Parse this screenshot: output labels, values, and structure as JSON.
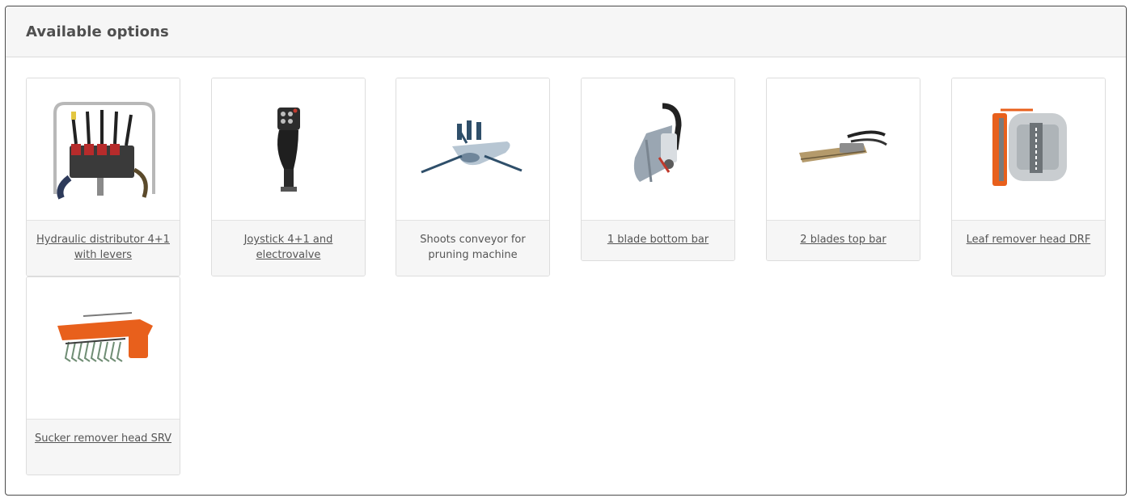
{
  "panel": {
    "title": "Available options"
  },
  "options": [
    {
      "label": "Hydraulic distributor 4+1 with levers",
      "linked": true,
      "icon": "hydraulic-distributor-image"
    },
    {
      "label": "Joystick 4+1 and electrovalve",
      "linked": true,
      "icon": "joystick-image"
    },
    {
      "label": "Shoots conveyor for pruning machine",
      "linked": false,
      "icon": "shoots-conveyor-image"
    },
    {
      "label": "1 blade bottom bar",
      "linked": true,
      "icon": "blade-bottom-bar-image"
    },
    {
      "label": "2 blades top bar",
      "linked": true,
      "icon": "blades-top-bar-image"
    },
    {
      "label": "Leaf remover head DRF",
      "linked": true,
      "icon": "leaf-remover-image"
    },
    {
      "label": "Sucker remover head SRV",
      "linked": true,
      "icon": "sucker-remover-image"
    }
  ],
  "colors": {
    "border": "#4a4a4a",
    "header_bg": "#f6f6f6",
    "text": "#555555",
    "accent_orange": "#e8601c"
  }
}
